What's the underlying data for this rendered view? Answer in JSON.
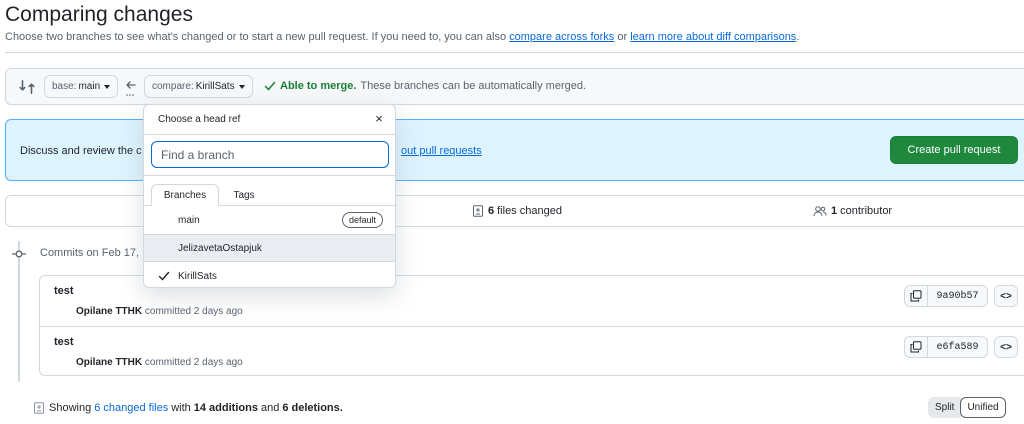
{
  "header": {
    "title": "Comparing changes",
    "subtitle_prefix": "Choose two branches to see what's changed or to start a new pull request. If you need to, you can also ",
    "compare_forks_link": "compare across forks",
    "subtitle_or": " or ",
    "learn_more_link": "learn more about diff comparisons",
    "subtitle_suffix": "."
  },
  "range": {
    "base_label": "base:",
    "base_value": "main",
    "compare_label": "compare:",
    "compare_value": "KirillSats",
    "merge_ok": "Able to merge.",
    "merge_text": "These branches can be automatically merged."
  },
  "discuss": {
    "text": "Discuss and review the c",
    "link": "out pull requests",
    "create_button": "Create pull request"
  },
  "stats": {
    "files_count": "6",
    "files_label": "files changed",
    "contributors_count": "1",
    "contributors_label": "contributor"
  },
  "commits": {
    "heading": "Commits on Feb 17,",
    "items": [
      {
        "title": "test",
        "author": "Opilane TTHK",
        "meta": "committed 2 days ago",
        "sha": "9a90b57"
      },
      {
        "title": "test",
        "author": "Opilane TTHK",
        "meta": "committed 2 days ago",
        "sha": "e6fa589"
      }
    ],
    "browse_label": "<>"
  },
  "summary": {
    "prefix": "Showing",
    "changed_files": "6 changed files",
    "with": "with",
    "additions": "14 additions",
    "and": "and",
    "deletions": "6 deletions."
  },
  "view_toggle": {
    "split": "Split",
    "unified": "Unified"
  },
  "dropdown": {
    "title": "Choose a head ref",
    "close": "×",
    "search_placeholder": "Find a branch",
    "tabs": [
      "Branches",
      "Tags"
    ],
    "branches": [
      {
        "name": "main",
        "badge": "default",
        "selected": false
      },
      {
        "name": "JelizavetaOstapjuk",
        "selected": false
      },
      {
        "name": "KirillSats",
        "selected": true
      }
    ]
  },
  "colors": {
    "accent": "#0969da",
    "success": "#1f883d",
    "info_bg": "#ddf4ff"
  }
}
